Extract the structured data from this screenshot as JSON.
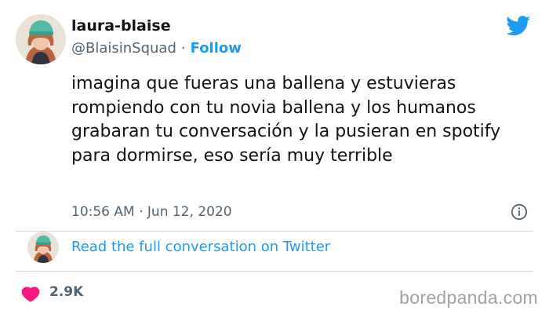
{
  "author": {
    "display_name": "laura-blaise",
    "handle": "@BlaisinSquad",
    "separator": "·",
    "follow_label": "Follow"
  },
  "tweet": {
    "text": "imagina que fueras una ballena y estuvieras rompiendo con tu novia ballena y los humanos grabaran tu conversación y la pusieran en spotify para dormirse, eso sería muy terrible",
    "timestamp": "10:56 AM · Jun 12, 2020"
  },
  "conversation": {
    "link_label": "Read the full conversation on Twitter"
  },
  "engagement": {
    "likes": "2.9K"
  },
  "watermark": {
    "text": "boredpanda.com"
  },
  "icons": {
    "logo": "twitter-bird-icon",
    "info": "info-icon",
    "like": "heart-icon"
  },
  "colors": {
    "accent": "#1d9bf0",
    "heart": "#f91880",
    "muted_text": "#536471",
    "primary_text": "#0f1419",
    "divider": "#cfd9de"
  }
}
